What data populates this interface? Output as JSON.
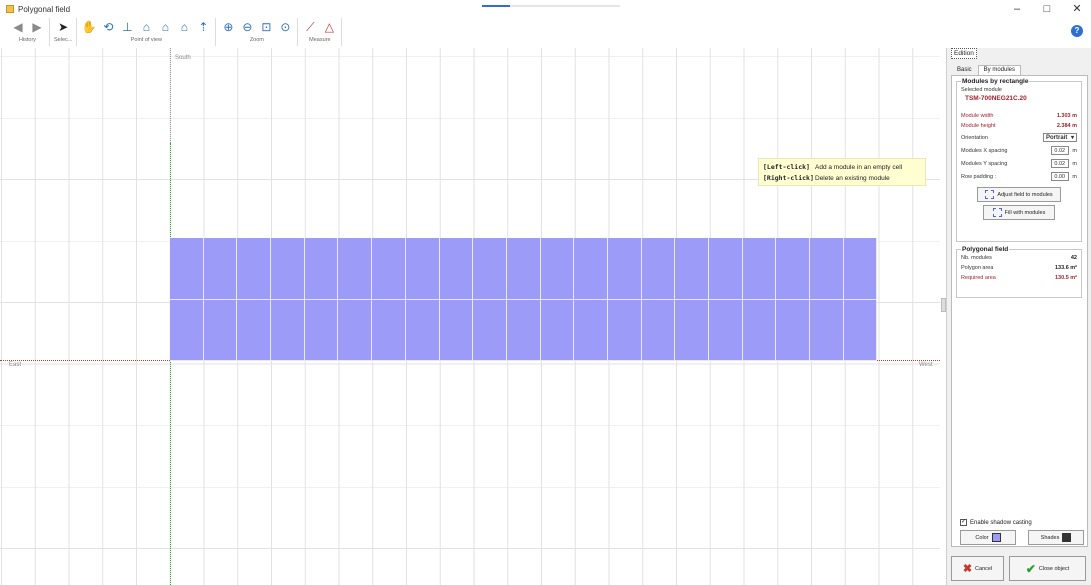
{
  "window": {
    "title": "Polygonal field",
    "progress": 0.2,
    "controls": {
      "minimize": "–",
      "maximize": "□",
      "close": "✕"
    }
  },
  "toolbar": {
    "groups": [
      {
        "label": "History",
        "icons": [
          "arrow-left-icon",
          "arrow-right-icon"
        ]
      },
      {
        "label": "Selec...",
        "icons": [
          "cursor-icon"
        ]
      },
      {
        "label": "Point of view",
        "icons": [
          "hand-icon",
          "rotate-3d-icon",
          "view-axes-icon",
          "view-front-icon",
          "view-side-icon",
          "view-top-icon",
          "view-up-icon"
        ]
      },
      {
        "label": "Zoom",
        "icons": [
          "zoom-in-icon",
          "zoom-out-icon",
          "zoom-rect-icon",
          "zoom-fit-icon"
        ]
      },
      {
        "label": "Measure",
        "icons": [
          "measure-line-icon",
          "measure-angle-icon"
        ]
      }
    ],
    "help": "?"
  },
  "canvas": {
    "labels": {
      "south": "South",
      "east": "East",
      "west": "West"
    },
    "modules": {
      "columns": 21,
      "rows": 2
    },
    "tooltip": {
      "left_key": "[Left-click]",
      "left_text": "Add a module in an empty cell",
      "right_key": "[Right-click]",
      "right_text": "Delete an existing module"
    }
  },
  "panel": {
    "edition_label": "Edition",
    "tabs": [
      "Basic",
      "By modules"
    ],
    "active_tab": "By modules",
    "modules_by_rectangle": {
      "title": "Modules by rectangle",
      "selected_module_label": "Selected module",
      "selected_module": "TSM-700NEG21C.20",
      "module_width_label": "Module width",
      "module_width": "1.303 m",
      "module_height_label": "Module height",
      "module_height": "2.384 m",
      "orientation_label": "Orientation",
      "orientation": "Portrait",
      "x_spacing_label": "Modules X spacing",
      "x_spacing": "0.02",
      "y_spacing_label": "Modules Y spacing",
      "y_spacing": "0.02",
      "row_padding_label": "Row padding :",
      "row_padding": "0.00",
      "unit": "m",
      "adjust_button": "Adjust field to modules",
      "fill_button": "Fill with modules"
    },
    "polygonal_field": {
      "title": "Polygonal field",
      "nb_modules_label": "Nb. modules",
      "nb_modules": "42",
      "polygon_area_label": "Polygon area",
      "polygon_area": "133.6 m²",
      "required_area_label": "Required area",
      "required_area": "130.5 m²"
    },
    "shadow": {
      "enable_label": "Enable shadow casting",
      "enabled": true,
      "color_label": "Color",
      "shades_label": "Shades"
    },
    "footer": {
      "cancel": "Cancel",
      "close": "Close object"
    }
  },
  "colors": {
    "module": "#9c9cf8",
    "accent": "#2f6fd0",
    "warning_red": "#a0222e"
  }
}
